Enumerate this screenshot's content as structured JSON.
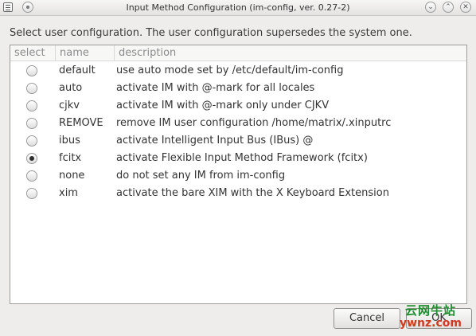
{
  "window": {
    "title": "Input Method Configuration (im-config, ver. 0.27-2)",
    "controls": {
      "menu_icon": "window-menu-icon",
      "sticky_icon": "sticky-icon",
      "minimize_glyph": "⌄",
      "maximize_glyph": "⌃",
      "close_glyph": "✕"
    }
  },
  "instruction": "Select user configuration. The user configuration supersedes the system one.",
  "table": {
    "headers": {
      "select": "select",
      "name": "name",
      "description": "description"
    },
    "rows": [
      {
        "name": "default",
        "description": "use auto mode set by /etc/default/im-config",
        "selected": false
      },
      {
        "name": "auto",
        "description": "activate IM with @-mark for all locales",
        "selected": false
      },
      {
        "name": "cjkv",
        "description": "activate IM with @-mark only under CJKV",
        "selected": false
      },
      {
        "name": "REMOVE",
        "description": "remove IM user configuration /home/matrix/.xinputrc",
        "selected": false
      },
      {
        "name": "ibus",
        "description": "activate Intelligent Input Bus (IBus) @",
        "selected": false
      },
      {
        "name": "fcitx",
        "description": "activate Flexible Input Method Framework (fcitx)",
        "selected": true
      },
      {
        "name": "none",
        "description": "do not set any IM from im-config",
        "selected": false
      },
      {
        "name": "xim",
        "description": "activate the bare XIM with the X Keyboard Extension",
        "selected": false
      }
    ]
  },
  "buttons": {
    "cancel": "Cancel",
    "ok": "OK"
  },
  "watermark": {
    "line1": "云网牛站",
    "line2": "ywnz.com"
  }
}
